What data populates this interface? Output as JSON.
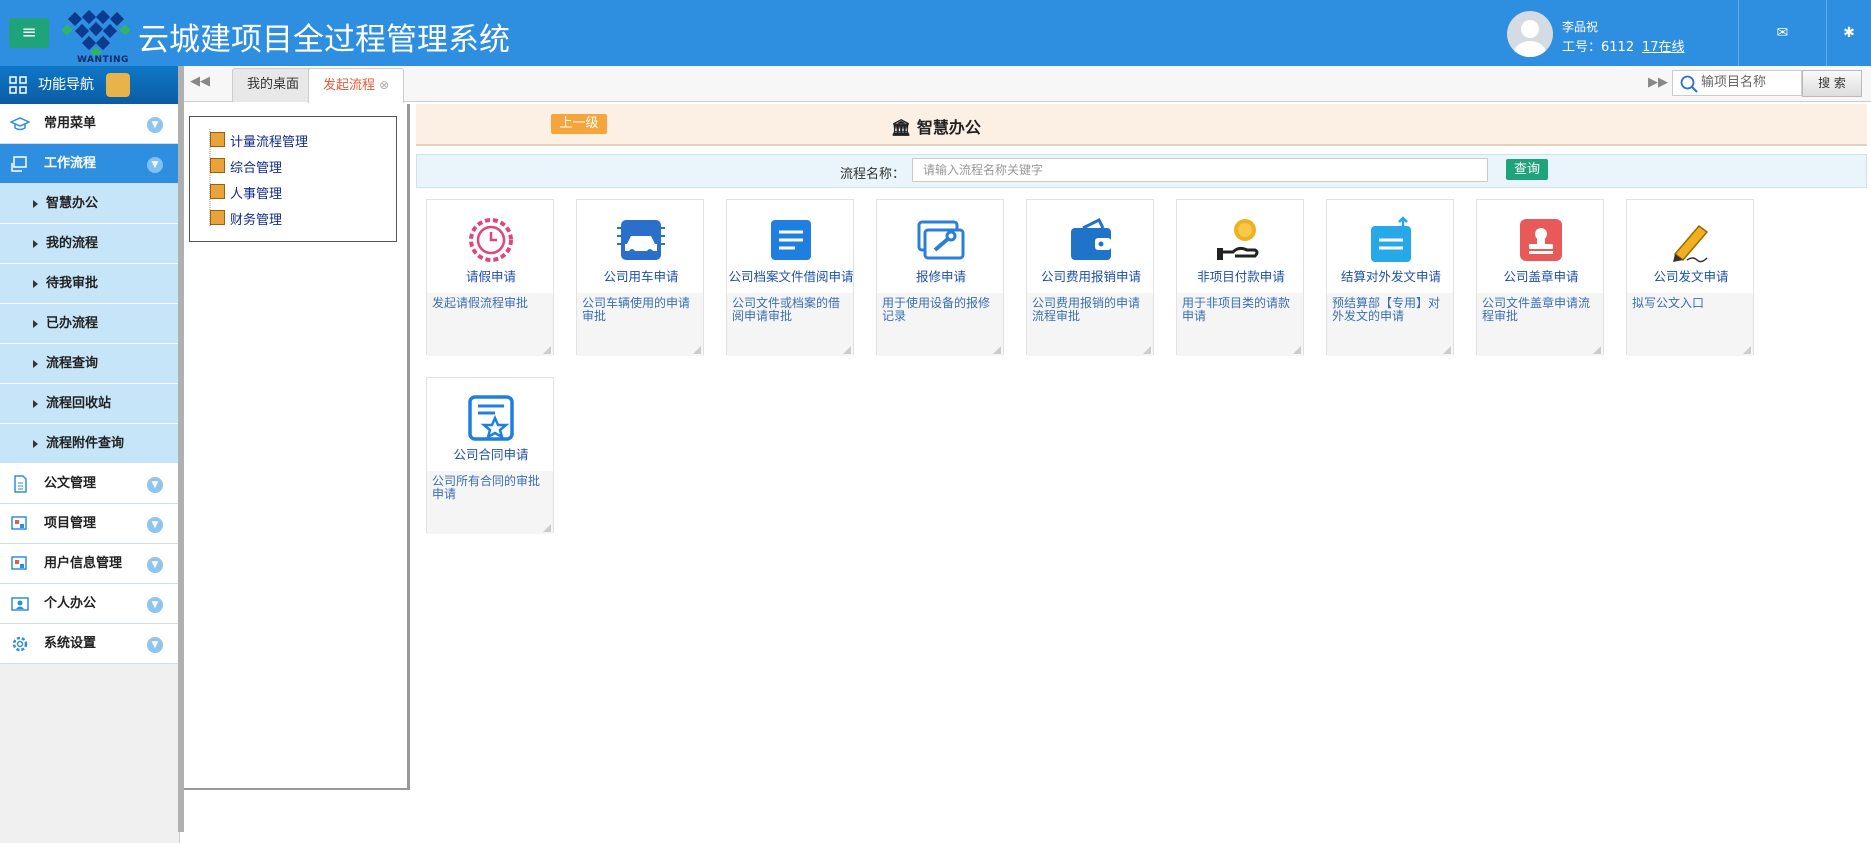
{
  "header": {
    "logo_text": "WANTING",
    "app_title": "云城建项目全过程管理系统",
    "user_name": "李品祝",
    "user_id": "工号：6112",
    "online": "17在线"
  },
  "sidebar": {
    "nav_title": "功能导航",
    "sections": [
      {
        "label": "常用菜单",
        "icon": "graduation-cap-icon"
      },
      {
        "label": "工作流程",
        "icon": "workflow-icon",
        "active": true
      },
      {
        "label": "公文管理",
        "icon": "document-icon"
      },
      {
        "label": "项目管理",
        "icon": "project-icon"
      },
      {
        "label": "用户信息管理",
        "icon": "user-info-icon"
      },
      {
        "label": "个人办公",
        "icon": "personal-icon"
      },
      {
        "label": "系统设置",
        "icon": "gear-icon"
      }
    ],
    "sub_items": [
      "智慧办公",
      "我的流程",
      "待我审批",
      "已办流程",
      "流程查询",
      "流程回收站",
      "流程附件查询"
    ]
  },
  "tabs": {
    "desktop": "我的桌面",
    "start_flow": "发起流程",
    "search_placeholder": "输项目名称",
    "search_btn": "搜 索"
  },
  "tree": [
    "计量流程管理",
    "综合管理",
    "人事管理",
    "财务管理"
  ],
  "main": {
    "up_btn": "上一级",
    "title": "智慧办公",
    "filter_label": "流程名称：",
    "filter_placeholder": "请输入流程名称关键字",
    "query_btn": "查询"
  },
  "cards": [
    {
      "name": "请假申请",
      "desc": "发起请假流程审批",
      "icon": "clock-gear-icon",
      "color": "#e0457b"
    },
    {
      "name": "公司用车申请",
      "desc": "公司车辆使用的申请审批",
      "icon": "car-chip-icon",
      "color": "#2a6fc9"
    },
    {
      "name": "公司档案文件借阅申请",
      "desc": "公司文件或档案的借阅申请审批",
      "icon": "document-lines-icon",
      "color": "#1f7fe0"
    },
    {
      "name": "报修申请",
      "desc": "用于使用设备的报修记录",
      "icon": "wrench-icon",
      "color": "#2a7fd6"
    },
    {
      "name": "公司费用报销申请",
      "desc": "公司费用报销的申请流程审批",
      "icon": "wallet-icon",
      "color": "#1f73c8"
    },
    {
      "name": "非项目付款申请",
      "desc": "用于非项目类的请款申请",
      "icon": "coin-hand-icon",
      "color": "#f0b020"
    },
    {
      "name": "结算对外发文申请",
      "desc": "预结算部【专用】对外发文的申请",
      "icon": "upload-doc-icon",
      "color": "#27a8e8"
    },
    {
      "name": "公司盖章申请",
      "desc": "公司文件盖章申请流程审批",
      "icon": "stamp-icon",
      "color": "#e85a5a"
    },
    {
      "name": "公司发文申请",
      "desc": "拟写公文入口",
      "icon": "pen-icon",
      "color": "#f0b020"
    },
    {
      "name": "公司合同申请",
      "desc": "公司所有合同的审批申请",
      "icon": "contract-star-icon",
      "color": "#1f7fe0"
    }
  ]
}
